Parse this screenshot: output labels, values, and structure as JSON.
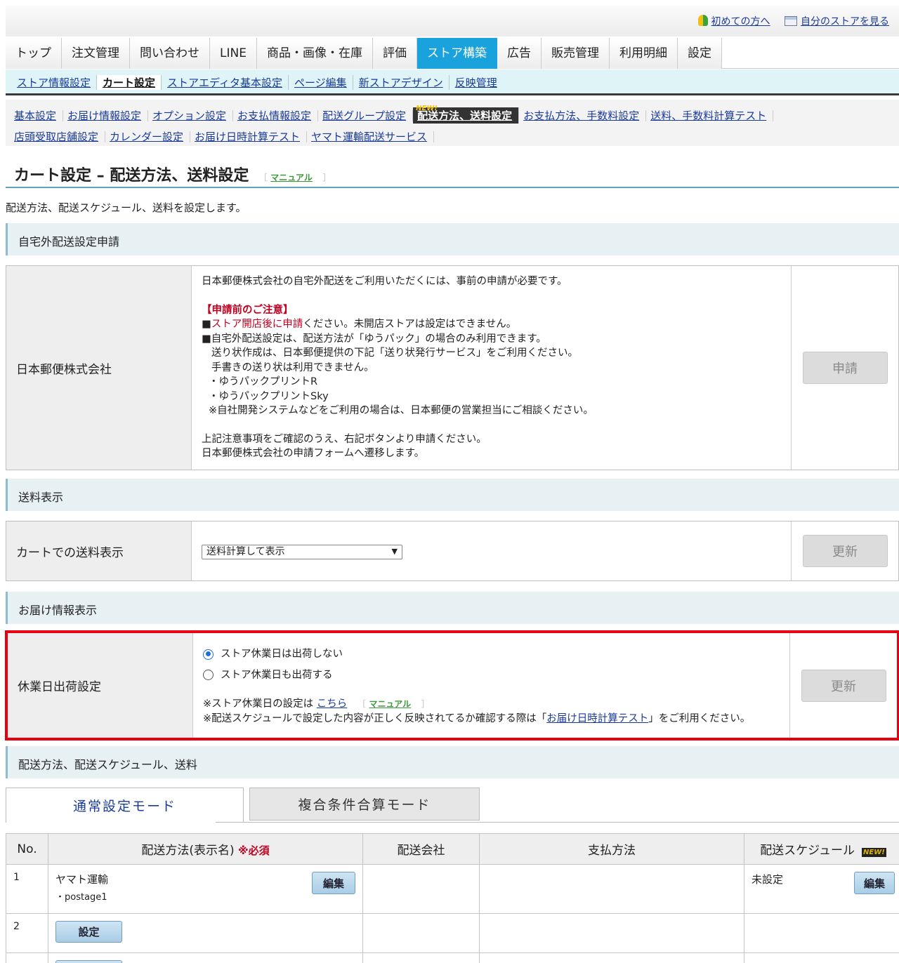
{
  "header": {
    "first_time_link": "初めての方へ",
    "my_store_link": "自分のストアを見る"
  },
  "main_nav": [
    {
      "label": "トップ",
      "active": false
    },
    {
      "label": "注文管理",
      "active": false
    },
    {
      "label": "問い合わせ",
      "active": false
    },
    {
      "label": "LINE",
      "active": false
    },
    {
      "label": "商品・画像・在庫",
      "active": false
    },
    {
      "label": "評価",
      "active": false
    },
    {
      "label": "ストア構築",
      "active": true
    },
    {
      "label": "広告",
      "active": false
    },
    {
      "label": "販売管理",
      "active": false
    },
    {
      "label": "利用明細",
      "active": false
    },
    {
      "label": "設定",
      "active": false
    }
  ],
  "sub_nav": [
    {
      "label": "ストア情報設定"
    },
    {
      "label": "カート設定",
      "active": true
    },
    {
      "label": "ストアエディタ基本設定"
    },
    {
      "label": "ページ編集"
    },
    {
      "label": "新ストアデザイン"
    },
    {
      "label": "反映管理"
    }
  ],
  "third_nav": [
    {
      "label": "基本設定"
    },
    {
      "label": "お届け情報設定"
    },
    {
      "label": "オプション設定"
    },
    {
      "label": "お支払情報設定"
    },
    {
      "label": "配送グループ設定"
    },
    {
      "label": "配送方法、送料設定",
      "active": true,
      "badge": "NEW!"
    },
    {
      "label": "お支払方法、手数料設定"
    },
    {
      "label": "送料、手数料計算テスト"
    },
    {
      "label": "店頭受取店舗設定"
    },
    {
      "label": "カレンダー設定"
    },
    {
      "label": "お届け日時計算テスト"
    },
    {
      "label": "ヤマト運輸配送サービス"
    }
  ],
  "page": {
    "title": "カート設定 – 配送方法、送料設定",
    "manual": "マニュアル",
    "bracket_open": "［",
    "bracket_close": "］",
    "description": "配送方法、配送スケジュール、送料を設定します。"
  },
  "section_yubin": {
    "heading": "自宅外配送設定申請",
    "label": "日本郵便株式会社",
    "line1": "日本郵便株式会社の自宅外配送をご利用いただくには、事前の申請が必要です。",
    "notice_title": "【申請前のご注意】",
    "notice1_red": "ストア開店後に申請",
    "notice1_rest": "ください。未開店ストアは設定はできません。",
    "square": "■",
    "notice2": "自宅外配送設定は、配送方法が「ゆうパック」の場合のみ利用できます。",
    "notice3": "送り状作成は、日本郵便提供の下記「送り状発行サービス」をご利用ください。",
    "notice4": "手書きの送り状は利用できません。",
    "notice5": "・ゆうパックプリントR",
    "notice6": "・ゆうパックプリントSky",
    "notice7": "※自社開発システムなどをご利用の場合は、日本郵便の営業担当にご相談ください。",
    "footer1": "上記注意事項をご確認のうえ、右記ボタンより申請ください。",
    "footer2": "日本郵便株式会社の申請フォームへ遷移します。",
    "button": "申請"
  },
  "section_fee": {
    "heading": "送料表示",
    "label": "カートでの送料表示",
    "select_value": "送料計算して表示",
    "button": "更新"
  },
  "section_delivery": {
    "heading": "お届け情報表示",
    "label": "休業日出荷設定",
    "options": [
      {
        "label": "ストア休業日は出荷しない",
        "checked": true
      },
      {
        "label": "ストア休業日も出荷する",
        "checked": false
      }
    ],
    "note1_prefix": "※ストア休業日の設定は",
    "note1_link": "こちら",
    "note1_manual": "マニュアル",
    "note2_prefix": "※配送スケジュールで設定した内容が正しく反映されてるか確認する際は「",
    "note2_link": "お届け日時計算テスト",
    "note2_suffix": "」をご利用ください。",
    "button": "更新"
  },
  "section_methods": {
    "heading": "配送方法、配送スケジュール、送料",
    "tabs": [
      {
        "label": "通常設定モード",
        "active": true
      },
      {
        "label": "複合条件合算モード",
        "active": false
      }
    ],
    "columns": {
      "no": "No.",
      "method": "配送方法(表示名)",
      "required": "※必須",
      "company": "配送会社",
      "payment": "支払方法",
      "schedule": "配送スケジュール",
      "new_badge": "NEW!"
    },
    "rows": [
      {
        "no": "1",
        "method": "ヤマト運輸",
        "sub": "・postage1",
        "edit": "編集",
        "schedule": "未設定",
        "schedule_edit": "編集"
      },
      {
        "no": "2",
        "set_button": "設定"
      }
    ]
  },
  "colors": {
    "accent": "#1aa2dd",
    "highlight_border": "#e60012",
    "section_bg": "#e7f1f4"
  }
}
